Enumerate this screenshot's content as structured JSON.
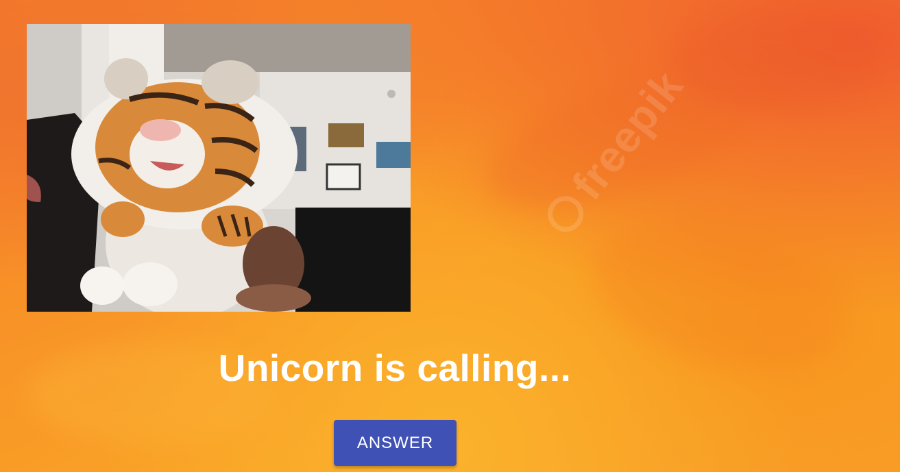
{
  "incoming_call": {
    "message": "Unicorn is calling...",
    "answer_label": "ANSWER"
  },
  "watermark": {
    "text": "freepik"
  },
  "video_feed": {
    "icon": "video-camera-feed"
  },
  "colors": {
    "background_orange": "#f89327",
    "button_primary": "#3f51b5",
    "text": "#ffffff"
  }
}
